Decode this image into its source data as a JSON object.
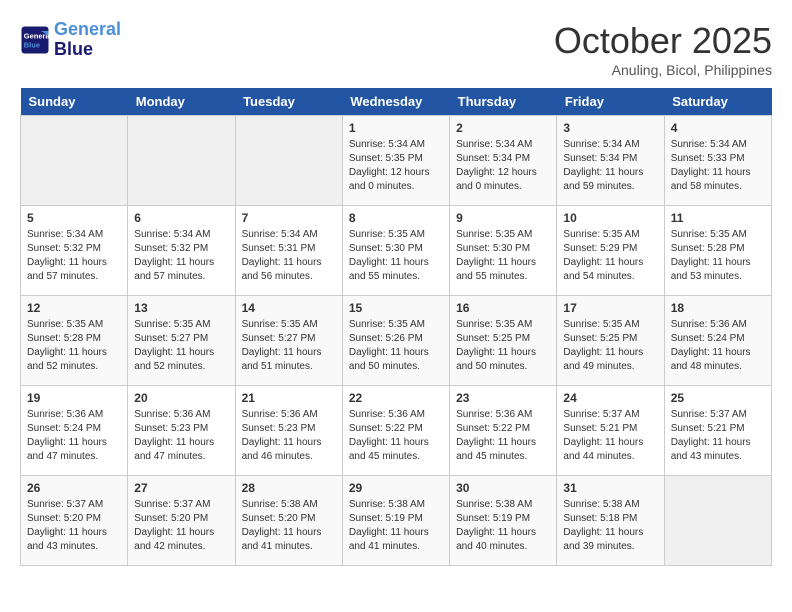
{
  "header": {
    "logo_line1": "General",
    "logo_line2": "Blue",
    "month": "October 2025",
    "location": "Anuling, Bicol, Philippines"
  },
  "days_of_week": [
    "Sunday",
    "Monday",
    "Tuesday",
    "Wednesday",
    "Thursday",
    "Friday",
    "Saturday"
  ],
  "weeks": [
    [
      {
        "day": "",
        "sunrise": "",
        "sunset": "",
        "daylight": ""
      },
      {
        "day": "",
        "sunrise": "",
        "sunset": "",
        "daylight": ""
      },
      {
        "day": "",
        "sunrise": "",
        "sunset": "",
        "daylight": ""
      },
      {
        "day": "1",
        "sunrise": "Sunrise: 5:34 AM",
        "sunset": "Sunset: 5:35 PM",
        "daylight": "Daylight: 12 hours and 0 minutes."
      },
      {
        "day": "2",
        "sunrise": "Sunrise: 5:34 AM",
        "sunset": "Sunset: 5:34 PM",
        "daylight": "Daylight: 12 hours and 0 minutes."
      },
      {
        "day": "3",
        "sunrise": "Sunrise: 5:34 AM",
        "sunset": "Sunset: 5:34 PM",
        "daylight": "Daylight: 11 hours and 59 minutes."
      },
      {
        "day": "4",
        "sunrise": "Sunrise: 5:34 AM",
        "sunset": "Sunset: 5:33 PM",
        "daylight": "Daylight: 11 hours and 58 minutes."
      }
    ],
    [
      {
        "day": "5",
        "sunrise": "Sunrise: 5:34 AM",
        "sunset": "Sunset: 5:32 PM",
        "daylight": "Daylight: 11 hours and 57 minutes."
      },
      {
        "day": "6",
        "sunrise": "Sunrise: 5:34 AM",
        "sunset": "Sunset: 5:32 PM",
        "daylight": "Daylight: 11 hours and 57 minutes."
      },
      {
        "day": "7",
        "sunrise": "Sunrise: 5:34 AM",
        "sunset": "Sunset: 5:31 PM",
        "daylight": "Daylight: 11 hours and 56 minutes."
      },
      {
        "day": "8",
        "sunrise": "Sunrise: 5:35 AM",
        "sunset": "Sunset: 5:30 PM",
        "daylight": "Daylight: 11 hours and 55 minutes."
      },
      {
        "day": "9",
        "sunrise": "Sunrise: 5:35 AM",
        "sunset": "Sunset: 5:30 PM",
        "daylight": "Daylight: 11 hours and 55 minutes."
      },
      {
        "day": "10",
        "sunrise": "Sunrise: 5:35 AM",
        "sunset": "Sunset: 5:29 PM",
        "daylight": "Daylight: 11 hours and 54 minutes."
      },
      {
        "day": "11",
        "sunrise": "Sunrise: 5:35 AM",
        "sunset": "Sunset: 5:28 PM",
        "daylight": "Daylight: 11 hours and 53 minutes."
      }
    ],
    [
      {
        "day": "12",
        "sunrise": "Sunrise: 5:35 AM",
        "sunset": "Sunset: 5:28 PM",
        "daylight": "Daylight: 11 hours and 52 minutes."
      },
      {
        "day": "13",
        "sunrise": "Sunrise: 5:35 AM",
        "sunset": "Sunset: 5:27 PM",
        "daylight": "Daylight: 11 hours and 52 minutes."
      },
      {
        "day": "14",
        "sunrise": "Sunrise: 5:35 AM",
        "sunset": "Sunset: 5:27 PM",
        "daylight": "Daylight: 11 hours and 51 minutes."
      },
      {
        "day": "15",
        "sunrise": "Sunrise: 5:35 AM",
        "sunset": "Sunset: 5:26 PM",
        "daylight": "Daylight: 11 hours and 50 minutes."
      },
      {
        "day": "16",
        "sunrise": "Sunrise: 5:35 AM",
        "sunset": "Sunset: 5:25 PM",
        "daylight": "Daylight: 11 hours and 50 minutes."
      },
      {
        "day": "17",
        "sunrise": "Sunrise: 5:35 AM",
        "sunset": "Sunset: 5:25 PM",
        "daylight": "Daylight: 11 hours and 49 minutes."
      },
      {
        "day": "18",
        "sunrise": "Sunrise: 5:36 AM",
        "sunset": "Sunset: 5:24 PM",
        "daylight": "Daylight: 11 hours and 48 minutes."
      }
    ],
    [
      {
        "day": "19",
        "sunrise": "Sunrise: 5:36 AM",
        "sunset": "Sunset: 5:24 PM",
        "daylight": "Daylight: 11 hours and 47 minutes."
      },
      {
        "day": "20",
        "sunrise": "Sunrise: 5:36 AM",
        "sunset": "Sunset: 5:23 PM",
        "daylight": "Daylight: 11 hours and 47 minutes."
      },
      {
        "day": "21",
        "sunrise": "Sunrise: 5:36 AM",
        "sunset": "Sunset: 5:23 PM",
        "daylight": "Daylight: 11 hours and 46 minutes."
      },
      {
        "day": "22",
        "sunrise": "Sunrise: 5:36 AM",
        "sunset": "Sunset: 5:22 PM",
        "daylight": "Daylight: 11 hours and 45 minutes."
      },
      {
        "day": "23",
        "sunrise": "Sunrise: 5:36 AM",
        "sunset": "Sunset: 5:22 PM",
        "daylight": "Daylight: 11 hours and 45 minutes."
      },
      {
        "day": "24",
        "sunrise": "Sunrise: 5:37 AM",
        "sunset": "Sunset: 5:21 PM",
        "daylight": "Daylight: 11 hours and 44 minutes."
      },
      {
        "day": "25",
        "sunrise": "Sunrise: 5:37 AM",
        "sunset": "Sunset: 5:21 PM",
        "daylight": "Daylight: 11 hours and 43 minutes."
      }
    ],
    [
      {
        "day": "26",
        "sunrise": "Sunrise: 5:37 AM",
        "sunset": "Sunset: 5:20 PM",
        "daylight": "Daylight: 11 hours and 43 minutes."
      },
      {
        "day": "27",
        "sunrise": "Sunrise: 5:37 AM",
        "sunset": "Sunset: 5:20 PM",
        "daylight": "Daylight: 11 hours and 42 minutes."
      },
      {
        "day": "28",
        "sunrise": "Sunrise: 5:38 AM",
        "sunset": "Sunset: 5:20 PM",
        "daylight": "Daylight: 11 hours and 41 minutes."
      },
      {
        "day": "29",
        "sunrise": "Sunrise: 5:38 AM",
        "sunset": "Sunset: 5:19 PM",
        "daylight": "Daylight: 11 hours and 41 minutes."
      },
      {
        "day": "30",
        "sunrise": "Sunrise: 5:38 AM",
        "sunset": "Sunset: 5:19 PM",
        "daylight": "Daylight: 11 hours and 40 minutes."
      },
      {
        "day": "31",
        "sunrise": "Sunrise: 5:38 AM",
        "sunset": "Sunset: 5:18 PM",
        "daylight": "Daylight: 11 hours and 39 minutes."
      },
      {
        "day": "",
        "sunrise": "",
        "sunset": "",
        "daylight": ""
      }
    ]
  ]
}
